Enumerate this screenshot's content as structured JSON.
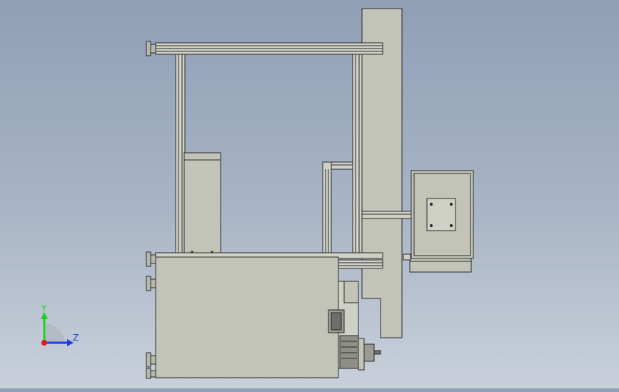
{
  "triad": {
    "y_label": "Y",
    "z_label": "Z",
    "y_color": "#1bd41b",
    "z_color": "#1f3fe0",
    "x_color": "#e01b1b"
  },
  "colors": {
    "part_fill": "#c3c4b8",
    "edge": "#2a2a2a",
    "profile_fill": "#cfd0c6"
  }
}
